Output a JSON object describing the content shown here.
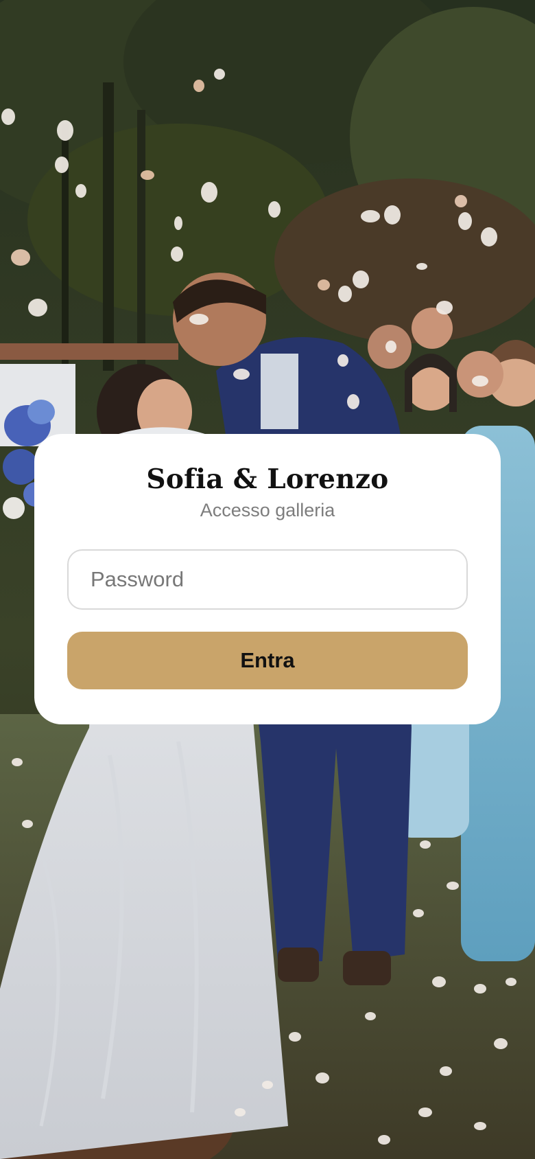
{
  "login": {
    "title": "Sofia & Lorenzo",
    "subtitle": "Accesso galleria",
    "password_placeholder": "Password",
    "password_value": "",
    "submit_label": "Entra"
  },
  "colors": {
    "accent": "#c9a46a",
    "card_background": "#ffffff",
    "title_text": "#111111",
    "subtitle_text": "#7d7d7d"
  },
  "background": {
    "image": "wedding-photo"
  }
}
